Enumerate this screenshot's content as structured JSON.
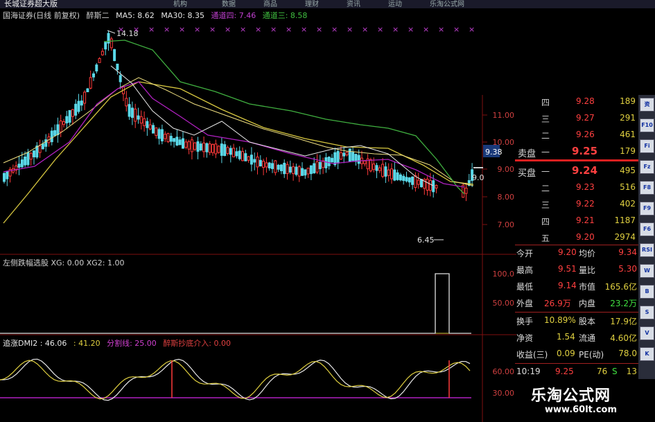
{
  "window": {
    "title": "长城证券超大版",
    "menu": [
      "机构",
      "数据",
      "商品",
      "理财",
      "资讯",
      "运动",
      "乐淘公式网"
    ]
  },
  "main_header": {
    "stock": "国海证券(日线 前复权)",
    "indicator": "醉斯二",
    "ma5": "MA5: 8.62",
    "ma30": "MA30: 8.35",
    "ch4": "通道四: 7.46",
    "ch3": "通道三: 8.58"
  },
  "main_labels": {
    "high": "14.18",
    "low": "6.45",
    "last": "9.0",
    "price_tag": "9.38"
  },
  "price_axis": [
    "11.00",
    "10.00",
    "9.00",
    "8.00",
    "7.00"
  ],
  "sub1": {
    "header": "左侧跌幅选股 XG: 0.00 XG2: 1.00",
    "axis": [
      "100.0",
      "50.00"
    ]
  },
  "sub2": {
    "title": "追涨DMI2 : 46.06",
    "val2": ": 41.20",
    "split": "分割线: 25.00",
    "entry": "醉斯抄底介入: 0.00",
    "axis": [
      "60.00",
      "30.00"
    ]
  },
  "quote": {
    "asks": [
      {
        "level": "四",
        "price": "9.28",
        "vol": "189"
      },
      {
        "level": "三",
        "price": "9.27",
        "vol": "291"
      },
      {
        "level": "二",
        "price": "9.26",
        "vol": "461"
      },
      {
        "level": "一",
        "price": "9.25",
        "vol": "179"
      }
    ],
    "bids": [
      {
        "level": "一",
        "price": "9.24",
        "vol": "495"
      },
      {
        "level": "二",
        "price": "9.23",
        "vol": "516"
      },
      {
        "level": "三",
        "price": "9.22",
        "vol": "402"
      },
      {
        "level": "四",
        "price": "9.21",
        "vol": "1187"
      },
      {
        "level": "五",
        "price": "9.20",
        "vol": "2974"
      }
    ],
    "sell_label": "卖盘",
    "buy_label": "买盘"
  },
  "stats": [
    {
      "l1": "今开",
      "v1": "9.20",
      "l2": "均价",
      "v2": "9.34"
    },
    {
      "l1": "最高",
      "v1": "9.51",
      "l2": "量比",
      "v2": "5.30"
    },
    {
      "l1": "最低",
      "v1": "9.14",
      "l2": "市值",
      "v2": "165.6亿"
    },
    {
      "l1": "外盘",
      "v1": "26.9万",
      "l2": "内盘",
      "v2": "23.2万"
    },
    {
      "l1": "换手",
      "v1": "10.89%",
      "l2": "股本",
      "v2": "17.9亿"
    },
    {
      "l1": "净资",
      "v1": "1.54",
      "l2": "流通",
      "v2": "4.60亿"
    },
    {
      "l1": "收益(三)",
      "v1": "0.09",
      "l2": "PE(动)",
      "v2": "78.0"
    }
  ],
  "tick": {
    "time": "10:19",
    "price": "9.25",
    "vol": "76",
    "side": "S",
    "num": "13"
  },
  "sidebar_buttons": [
    "资",
    "F10",
    "Fi",
    "Fz",
    "F8",
    "F9",
    "F6",
    "RSI",
    "W",
    "B",
    "S",
    "V",
    "K"
  ],
  "watermark": {
    "title": "乐淘公式网",
    "url": "www.60lt.com"
  },
  "colors": {
    "up": "#ff3a3a",
    "down": "#5ad8e8",
    "ma_white": "#e8e8e8",
    "ma_yellow": "#d8c840",
    "ma_green": "#40b040",
    "ma_purple": "#b020c0",
    "grid": "#801010"
  }
}
